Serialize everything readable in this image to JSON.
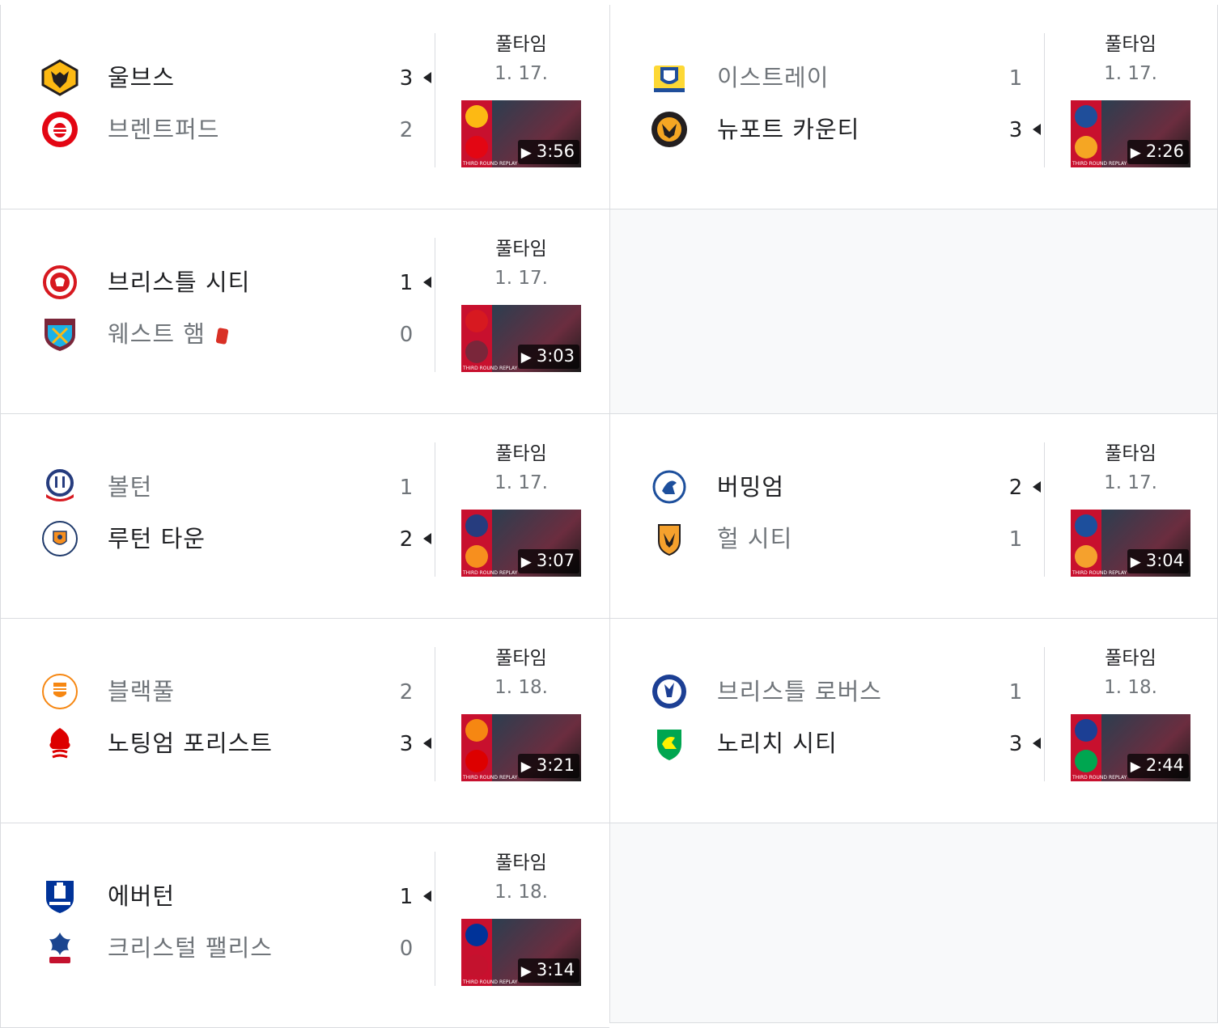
{
  "colors": {
    "border": "#dadce0",
    "winner_text": "#202124",
    "loser_text": "#70757a",
    "empty_bg": "#f8f9fa",
    "red_card": "#d93025"
  },
  "matches": [
    {
      "status": "풀타임",
      "date": "1. 17.",
      "home": {
        "name": "울브스",
        "score": "3",
        "winner": true,
        "logo": "wolves-crest",
        "logo_color": "#fdb913"
      },
      "away": {
        "name": "브렌트퍼드",
        "score": "2",
        "winner": false,
        "logo": "brentford-crest",
        "logo_color": "#e30613"
      },
      "video": {
        "duration": "3:56",
        "caption": "THIRD ROUND REPLAY",
        "colors": [
          "#fdb913",
          "#e30613"
        ]
      }
    },
    {
      "status": "풀타임",
      "date": "1. 17.",
      "home": {
        "name": "이스트레이",
        "score": "1",
        "winner": false,
        "logo": "eastleigh-crest",
        "logo_color": "#1f4e9a"
      },
      "away": {
        "name": "뉴포트 카운티",
        "score": "3",
        "winner": true,
        "logo": "newport-county-crest",
        "logo_color": "#f5a623"
      },
      "video": {
        "duration": "2:26",
        "caption": "THIRD ROUND REPLAY",
        "colors": [
          "#1f4e9a",
          "#f5a623"
        ]
      }
    },
    {
      "status": "풀타임",
      "date": "1. 17.",
      "home": {
        "name": "브리스틀 시티",
        "score": "1",
        "winner": true,
        "logo": "bristol-city-crest",
        "logo_color": "#d71920"
      },
      "away": {
        "name": "웨스트 햄",
        "score": "0",
        "winner": false,
        "logo": "west-ham-crest",
        "logo_color": "#7a263a",
        "red_card": true
      },
      "video": {
        "duration": "3:03",
        "caption": "THIRD ROUND REPLAY",
        "colors": [
          "#d71920",
          "#7a263a"
        ]
      }
    },
    {
      "status": "풀타임",
      "date": "1. 17.",
      "home": {
        "name": "볼턴",
        "score": "1",
        "winner": false,
        "logo": "bolton-crest",
        "logo_color": "#263c7e"
      },
      "away": {
        "name": "루턴 타운",
        "score": "2",
        "winner": true,
        "logo": "luton-town-crest",
        "logo_color": "#f78f1e"
      },
      "video": {
        "duration": "3:07",
        "caption": "THIRD ROUND REPLAY",
        "colors": [
          "#263c7e",
          "#f78f1e"
        ]
      }
    },
    {
      "status": "풀타임",
      "date": "1. 17.",
      "home": {
        "name": "버밍엄",
        "score": "2",
        "winner": true,
        "logo": "birmingham-crest",
        "logo_color": "#1d4f9c"
      },
      "away": {
        "name": "헐 시티",
        "score": "1",
        "winner": false,
        "logo": "hull-city-crest",
        "logo_color": "#f5a12d"
      },
      "video": {
        "duration": "3:04",
        "caption": "THIRD ROUND REPLAY",
        "colors": [
          "#1d4f9c",
          "#f5a12d"
        ]
      }
    },
    {
      "status": "풀타임",
      "date": "1. 18.",
      "home": {
        "name": "블랙풀",
        "score": "2",
        "winner": false,
        "logo": "blackpool-crest",
        "logo_color": "#f68712"
      },
      "away": {
        "name": "노팅엄 포리스트",
        "score": "3",
        "winner": true,
        "logo": "nottingham-forest-crest",
        "logo_color": "#dd0000"
      },
      "video": {
        "duration": "3:21",
        "caption": "THIRD ROUND REPLAY",
        "colors": [
          "#f68712",
          "#dd0000"
        ]
      }
    },
    {
      "status": "풀타임",
      "date": "1. 18.",
      "home": {
        "name": "브리스틀 로버스",
        "score": "1",
        "winner": false,
        "logo": "bristol-rovers-crest",
        "logo_color": "#1c3f94"
      },
      "away": {
        "name": "노리치 시티",
        "score": "3",
        "winner": true,
        "logo": "norwich-city-crest",
        "logo_color": "#fff200"
      },
      "video": {
        "duration": "2:44",
        "caption": "THIRD ROUND REPLAY",
        "colors": [
          "#1c3f94",
          "#00a650"
        ]
      }
    },
    {
      "status": "풀타임",
      "date": "1. 18.",
      "home": {
        "name": "에버턴",
        "score": "1",
        "winner": true,
        "logo": "everton-crest",
        "logo_color": "#003399"
      },
      "away": {
        "name": "크리스털 팰리스",
        "score": "0",
        "winner": false,
        "logo": "crystal-palace-crest",
        "logo_color": "#1b458f"
      },
      "video": {
        "duration": "3:14",
        "caption": "THIRD ROUND REPLAY",
        "colors": [
          "#003399",
          "#c4122e"
        ]
      }
    }
  ]
}
